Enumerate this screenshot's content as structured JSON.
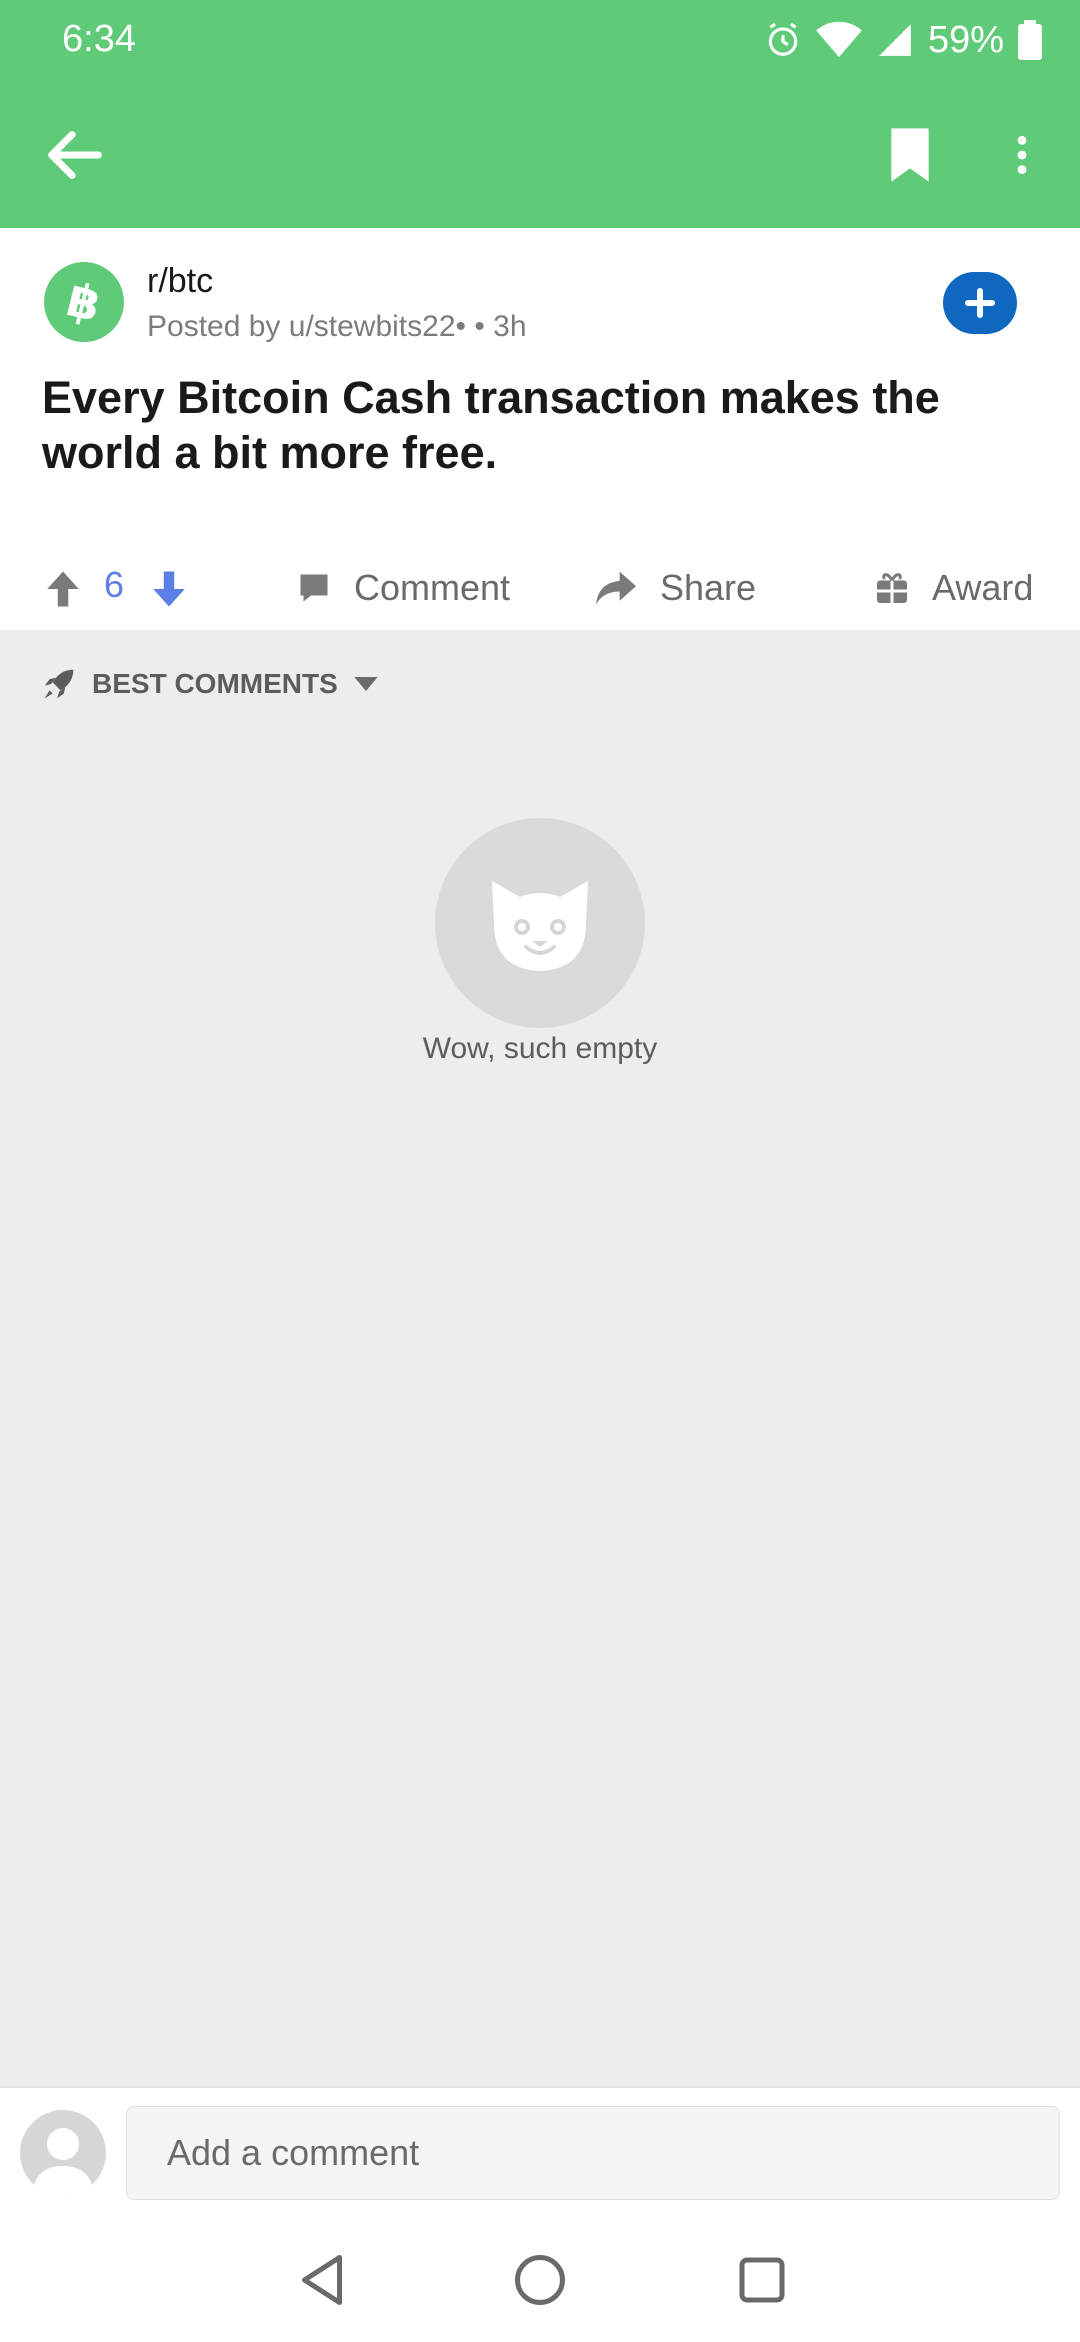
{
  "status_bar": {
    "time": "6:34",
    "battery_percent": "59%"
  },
  "app_bar": {
    "icons": [
      "back-arrow-icon",
      "bookmark-icon",
      "more-vert-icon"
    ]
  },
  "post": {
    "subreddit": "r/btc",
    "meta": "Posted by u/stewbits22• • 3h",
    "title": "Every Bitcoin Cash transaction makes the world a bit more free.",
    "score": "6",
    "actions": {
      "comment": "Comment",
      "share": "Share",
      "award": "Award"
    }
  },
  "comments": {
    "sort_label": "BEST COMMENTS",
    "empty_text": "Wow, such empty"
  },
  "composer": {
    "placeholder": "Add a comment"
  },
  "colors": {
    "accent_green": "#5FCB79",
    "join_blue": "#0F67BF",
    "vote_blue": "#5B7FE6"
  }
}
